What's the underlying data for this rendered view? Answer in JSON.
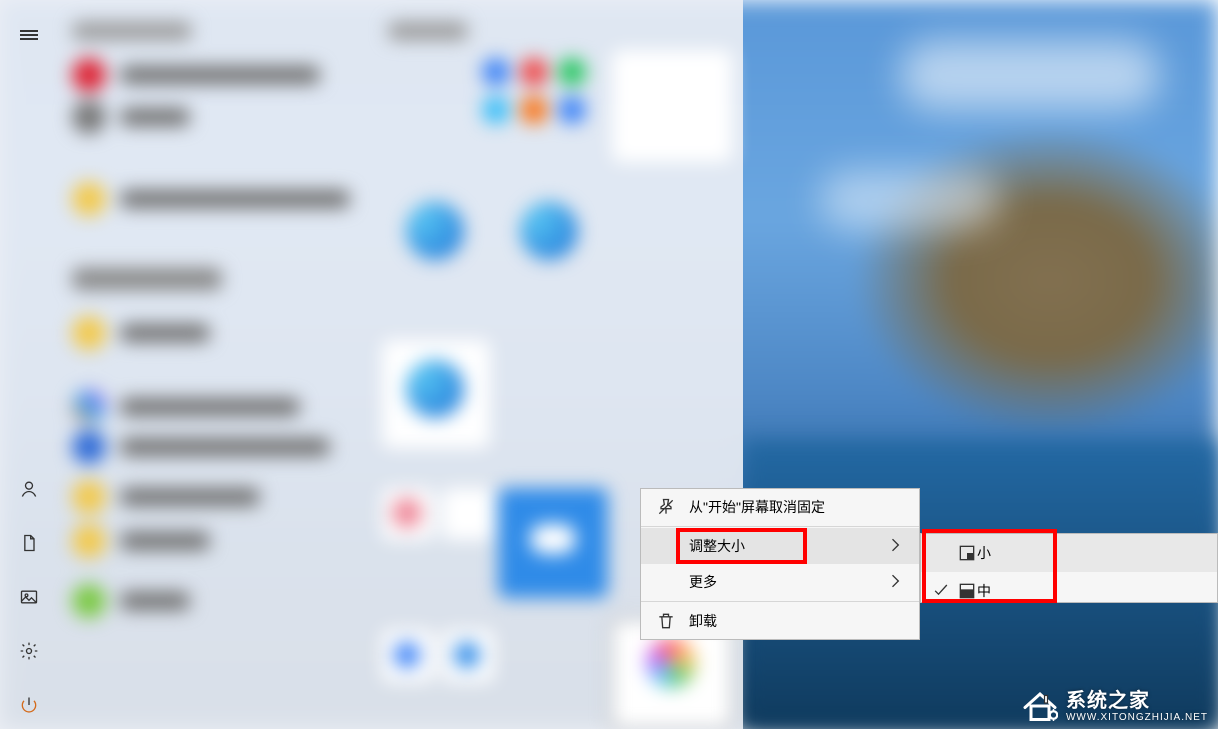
{
  "context_menu": {
    "unpin": "从\"开始\"屏幕取消固定",
    "resize": "调整大小",
    "more": "更多",
    "uninstall": "卸载"
  },
  "resize_submenu": {
    "small": "小",
    "medium": "中"
  },
  "rail": {
    "menu": "menu-icon",
    "account": "account-icon",
    "documents": "documents-icon",
    "pictures": "pictures-icon",
    "settings": "settings-icon",
    "power": "power-icon"
  },
  "watermark": {
    "title": "系统之家",
    "url": "WWW.XITONGZHIJIA.NET"
  }
}
